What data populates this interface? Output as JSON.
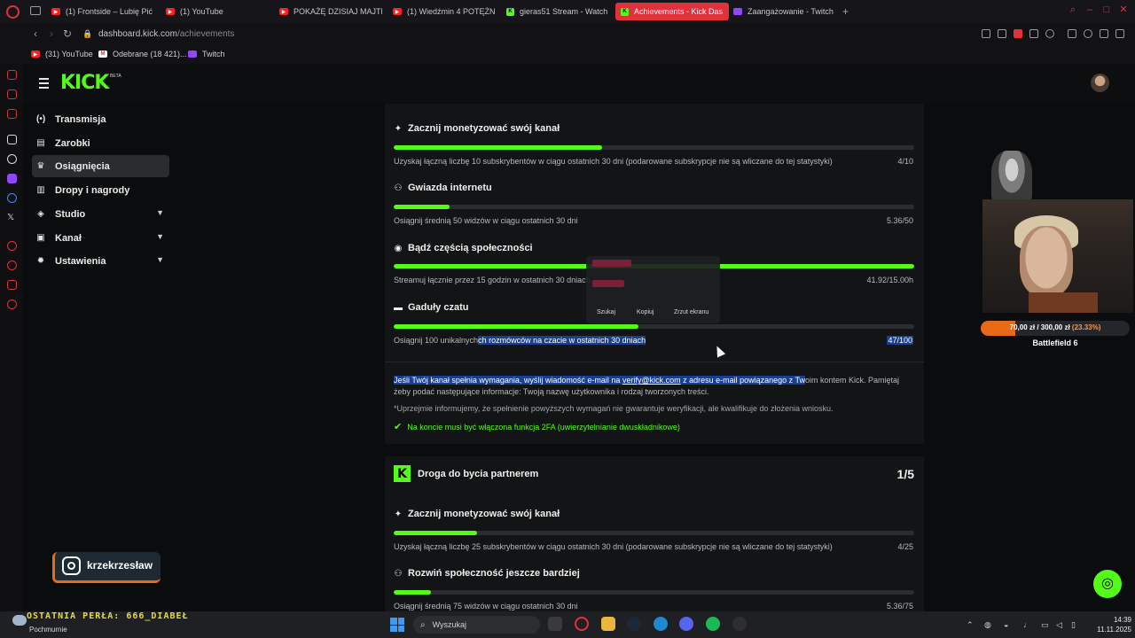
{
  "browser": {
    "tabs": [
      {
        "label": "(1) Frontside – Lubię Pić (",
        "icon": "youtube-icon"
      },
      {
        "label": "(1) YouTube",
        "icon": "youtube-icon"
      },
      {
        "label": "POKAŻĘ DZISIAJ MAJTK",
        "icon": "youtube-icon"
      },
      {
        "label": "(1) Wiedźmin 4 POTĘŻNI",
        "icon": "youtube-icon"
      },
      {
        "label": "gieras51 Stream - Watch",
        "icon": "kick-icon"
      },
      {
        "label": "Achievements - Kick Das",
        "icon": "kick-icon",
        "active": true
      },
      {
        "label": "Zaangażowanie - Twitch",
        "icon": "twitch-icon"
      }
    ],
    "url_host": "dashboard.kick.com",
    "url_path": "/achievements",
    "bookmarks": [
      "(31) YouTube",
      "Odebrane (18 421)...",
      "Twitch"
    ]
  },
  "header": {
    "logo": "KICK",
    "beta": "BETA"
  },
  "sidebar": {
    "items": [
      {
        "label": "Transmisja",
        "icon": "broadcast-icon"
      },
      {
        "label": "Zarobki",
        "icon": "wallet-icon"
      },
      {
        "label": "Osiągnięcia",
        "icon": "trophy-icon",
        "active": true
      },
      {
        "label": "Dropy i nagrody",
        "icon": "gift-icon"
      },
      {
        "label": "Studio",
        "icon": "studio-icon",
        "expandable": true
      },
      {
        "label": "Kanał",
        "icon": "channel-icon",
        "expandable": true
      },
      {
        "label": "Ustawienia",
        "icon": "gear-icon",
        "expandable": true
      }
    ]
  },
  "verified": {
    "achievements": [
      {
        "title": "Zacznij monetyzować swój kanał",
        "icon": "sparkle-icon",
        "desc": "Uzyskaj łączną liczbę 10 subskrybentów w ciągu ostatnich 30 dni (podarowane subskrypcje nie są wliczane do tej statystyki)",
        "value": "4/10",
        "progress": 0.4
      },
      {
        "title": "Gwiazda internetu",
        "icon": "users-icon",
        "desc": "Osiągnij średnią 50 widzów w ciągu ostatnich 30 dni",
        "value": "5.36/50",
        "progress": 0.107
      },
      {
        "title": "Bądź częścią społeczności",
        "icon": "broadcast-icon",
        "desc": "Streamuj łącznie przez 15 godzin w ostatnich 30 dniach",
        "value": "41.92/15.00h",
        "progress": 1.0
      },
      {
        "title": "Gaduły czatu",
        "icon": "chat-icon",
        "desc_a": "Osiągnij 100 unikalnych",
        "desc_b": "ch rozmówców na czacie w ostatnich 30 dniach",
        "value": "47/100",
        "progress": 0.47
      }
    ],
    "info_hl": "Jeśli Twój kanał spełnia wymagania, wyślij wiadomość e-mail na ",
    "info_email": "verify@kick.com",
    "info_hl2": " z adresu e-mail powiązanego z Tw",
    "info_rest": "oim kontem Kick. Pamiętaj żeby podać następujące informacje: Twoją nazwę użytkownika i rodzaj tworzonych treści.",
    "info_note": "*Uprzejmie informujemy, że spełnienie powyższych wymagań nie gwarantuje weryfikacji, ale kwalifikuje do złożenia wniosku.",
    "requirement": "Na koncie musi być włączona funkcja 2FA (uwierzytelnianie dwuskładnikowe)"
  },
  "partner": {
    "title": "Droga do bycia partnerem",
    "count": "1/5",
    "achievements": [
      {
        "title": "Zacznij monetyzować swój kanał",
        "icon": "sparkle-icon",
        "desc": "Uzyskaj łączną liczbę 25 subskrybentów w ciągu ostatnich 30 dni (podarowane subskrypcje nie są wliczane do tej statystyki)",
        "value": "4/25",
        "progress": 0.16
      },
      {
        "title": "Rozwiń społeczność jeszcze bardziej",
        "icon": "users-icon",
        "desc": "Osiągnij średnią 75 widzów w ciągu ostatnich 30 dni",
        "value": "5.36/75",
        "progress": 0.071
      }
    ]
  },
  "context_popup": {
    "search": "Szukaj",
    "copy": "Kopiuj",
    "screenshot": "Zrzut ekranu"
  },
  "overlay": {
    "goal": "70,00 zł / 300,00 zł",
    "goal_pct": "(23.33%)",
    "goal_progress": 0.2333,
    "game": "Battlefield 6",
    "instagram": "krzekrzesław",
    "ticker": "OSTATNIA PERŁA: 666_DIABEŁ"
  },
  "taskbar": {
    "weather": "Pochmurnie",
    "search_placeholder": "Wyszukaj",
    "time": "14:39",
    "date": "11.11.2025"
  },
  "colors": {
    "accent": "#53fc18",
    "opera_red": "#e0323b",
    "selection": "#1b3f8f",
    "goal_orange": "#e86a16"
  }
}
